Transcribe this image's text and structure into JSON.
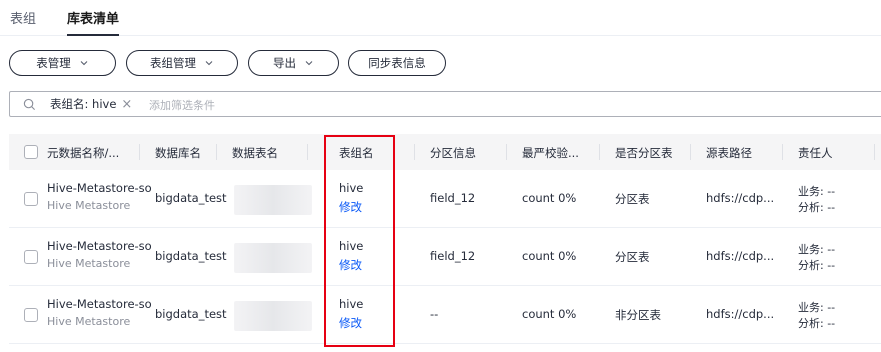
{
  "tabs": [
    {
      "label": "表组"
    },
    {
      "label": "库表清单"
    }
  ],
  "toolbar": {
    "buttons": [
      {
        "label": "表管理",
        "dropdown": true
      },
      {
        "label": "表组管理",
        "dropdown": true
      },
      {
        "label": "导出",
        "dropdown": true
      },
      {
        "label": "同步表信息",
        "dropdown": false
      }
    ]
  },
  "search": {
    "icon": "search-icon",
    "filter_chip": "表组名: hive",
    "placeholder": "添加筛选条件"
  },
  "table": {
    "columns": [
      "元数据名称/...",
      "数据库名",
      "数据表名",
      "表组名",
      "分区信息",
      "最严校验...",
      "是否分区表",
      "源表路径",
      "责任人"
    ],
    "edit_label": "修改",
    "rows": [
      {
        "meta_name": "Hive-Metastore-so",
        "meta_type": "Hive Metastore",
        "database": "bigdata_test",
        "table_group": "hive",
        "partition_info": "field_12",
        "strict_check": "count 0%",
        "is_partitioned": "分区表",
        "source_path": "hdfs://cdp...",
        "owner_business": "业务: --",
        "owner_analysis": "分析: --"
      },
      {
        "meta_name": "Hive-Metastore-so",
        "meta_type": "Hive Metastore",
        "database": "bigdata_test",
        "table_group": "hive",
        "partition_info": "field_12",
        "strict_check": "count 0%",
        "is_partitioned": "分区表",
        "source_path": "hdfs://cdp...",
        "owner_business": "业务: --",
        "owner_analysis": "分析: --"
      },
      {
        "meta_name": "Hive-Metastore-so",
        "meta_type": "Hive Metastore",
        "database": "bigdata_test",
        "table_group": "hive",
        "partition_info": "--",
        "strict_check": "count 0%",
        "is_partitioned": "非分区表",
        "source_path": "hdfs://cdp...",
        "owner_business": "业务: --",
        "owner_analysis": "分析: --"
      }
    ]
  },
  "colors": {
    "accent": "#0a59f7",
    "highlight": "#e60012"
  }
}
